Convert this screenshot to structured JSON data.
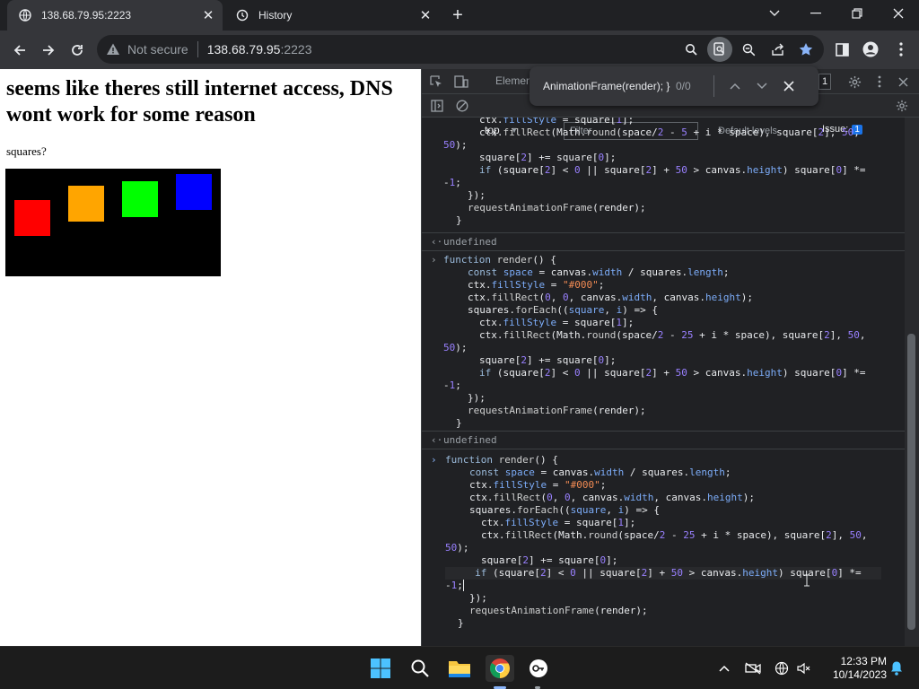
{
  "tabs": [
    {
      "title": "138.68.79.95:2223",
      "active": true
    },
    {
      "title": "History",
      "active": false
    }
  ],
  "omnibox": {
    "security": "Not secure",
    "host": "138.68.79.95",
    "port": ":2223"
  },
  "page": {
    "heading": "seems like theres still internet access, DNS wont work for some reason",
    "paragraph": "squares?",
    "canvas": {
      "background": "#000000",
      "squares": [
        {
          "color": "#ff0000"
        },
        {
          "color": "#ffa500"
        },
        {
          "color": "#00ff00"
        },
        {
          "color": "#0000ff"
        }
      ]
    }
  },
  "devtools": {
    "tab_elements": "Elemen",
    "context": "top",
    "filter_placeholder": "Filter",
    "levels": "Default levels",
    "issues_label": "Issue:",
    "issues_count": "1",
    "badge_count": "1",
    "find": {
      "query": "AnimationFrame(render); }",
      "count": "0/0"
    },
    "results": {
      "undefined_1": "undefined",
      "undefined_2": "undefined"
    }
  },
  "taskbar": {
    "time": "12:33 PM",
    "date": "10/14/2023"
  },
  "colors": {
    "accent": "#1a73e8",
    "star": "#8ab4f8"
  }
}
